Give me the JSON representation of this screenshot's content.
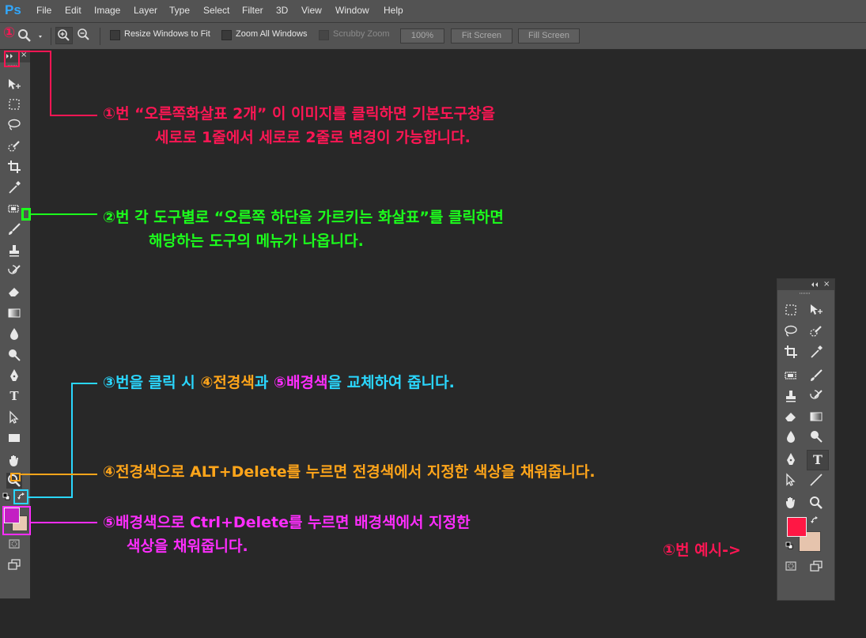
{
  "app": {
    "logo": "Ps"
  },
  "menubar": {
    "items": [
      "File",
      "Edit",
      "Image",
      "Layer",
      "Type",
      "Select",
      "Filter",
      "3D",
      "View",
      "Window",
      "Help"
    ]
  },
  "options_bar": {
    "resize_windows_to_fit": "Resize Windows to Fit",
    "zoom_all_windows": "Zoom All Windows",
    "scrubby_zoom": "Scrubby Zoom",
    "zoom_percent": "100%",
    "fit_screen": "Fit Screen",
    "fill_screen": "Fill Screen"
  },
  "annotations": {
    "a1_line1": "①번 “오른쪽화살표 2개” 이 이미지를 클릭하면 기본도구창을",
    "a1_line2": "세로로 1줄에서 세로로 2줄로 변경이 가능합니다.",
    "a2_line1": "②번 각 도구별로 “오른쪽 하단을 가르키는 화살표”를 클릭하면",
    "a2_line2": "해당하는 도구의 메뉴가 나옵니다.",
    "a3_p1": "③번을 클릭 시 ",
    "a3_p2": "④전경색",
    "a3_p3": "과 ",
    "a3_p4": "⑤배경색",
    "a3_p5": "을 교체하여 줍니다.",
    "a4": "④전경색으로 ALT+Delete를 누르면 전경색에서 지정한 색상을 채워줍니다.",
    "a5_line1": "⑤배경색으로 Ctrl+Delete를 누르면 배경색에서 지정한",
    "a5_line2": "색상을 채워줍니다.",
    "example": "①번 예시->"
  },
  "markers": {
    "m1": "①"
  },
  "colors": {
    "annotation_red": "#ff1654",
    "annotation_green": "#1cff1c",
    "annotation_cyan": "#2ad7ff",
    "annotation_orange": "#ffa51a",
    "annotation_magenta": "#ff2dff",
    "foreground_left": "#c31fc3",
    "background_left": "#e8c9b3",
    "foreground_right": "#ff1744",
    "background_right": "#e6c4ad"
  }
}
